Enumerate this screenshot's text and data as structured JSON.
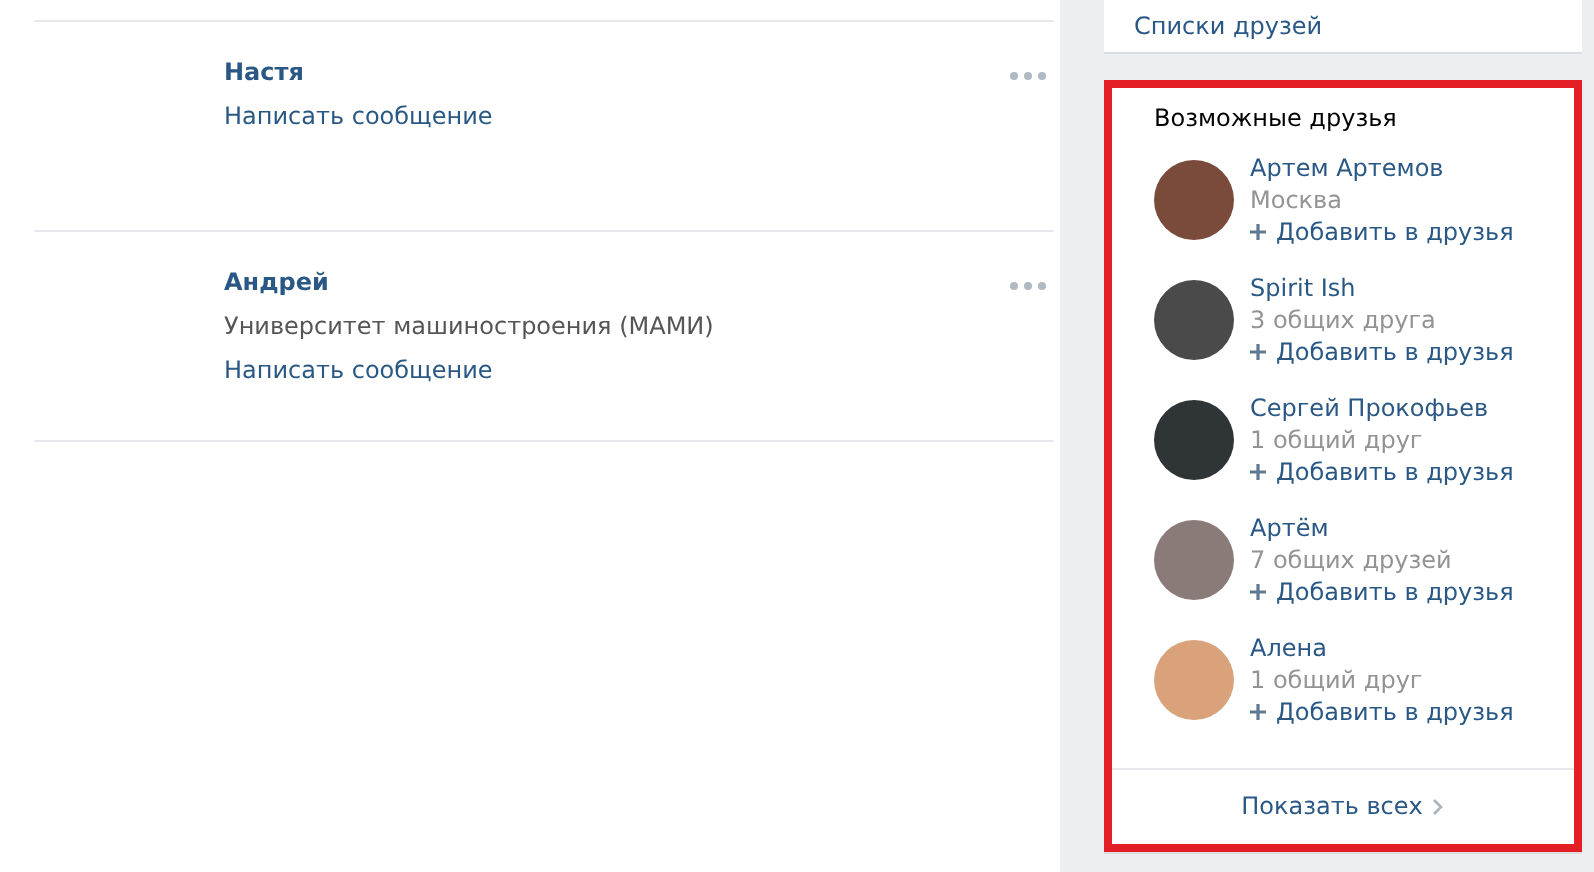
{
  "friends": [
    {
      "name": "Настя",
      "action": "Написать сообщение"
    },
    {
      "name": "Андрей",
      "info": "Университет машиностроения (МАМИ)",
      "action": "Написать сообщение"
    }
  ],
  "lists_link": "Списки друзей",
  "suggestions": {
    "title": "Возможные друзья",
    "highlighted": true,
    "items": [
      {
        "name": "Артем Артемов",
        "info": "Москва",
        "add": "Добавить в друзья",
        "color": "#7a4a3a"
      },
      {
        "name": "Spirit Ish",
        "info": "3 общих друга",
        "add": "Добавить в друзья",
        "color": "#4a4a4a"
      },
      {
        "name": "Сергей Прокофьев",
        "info": "1 общий друг",
        "add": "Добавить в друзья",
        "color": "#2f3436"
      },
      {
        "name": "Артём",
        "info": "7 общих друзей",
        "add": "Добавить в друзья",
        "color": "#8a7a78"
      },
      {
        "name": "Алена",
        "info": "1 общий друг",
        "add": "Добавить в друзья",
        "color": "#d9a27a"
      }
    ],
    "show_all": "Показать всех"
  }
}
